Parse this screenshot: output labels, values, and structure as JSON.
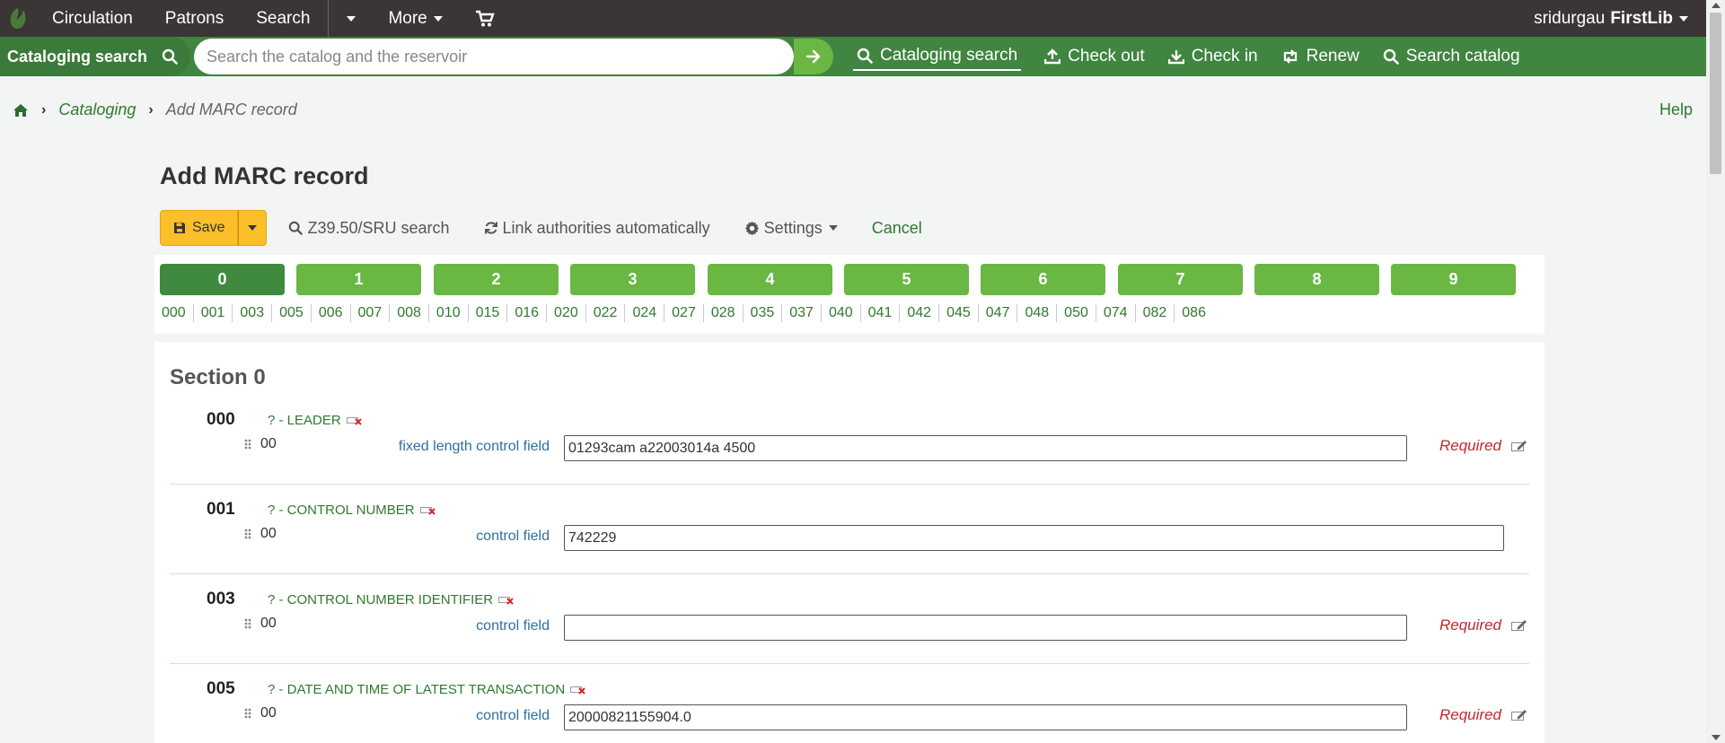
{
  "topnav": {
    "items": [
      "Circulation",
      "Patrons",
      "Search"
    ],
    "more_label": "More",
    "user_name": "sridurgau",
    "library": "FirstLib"
  },
  "searchbar": {
    "label": "Cataloging search",
    "placeholder": "Search the catalog and the reservoir",
    "quick_links": [
      "Cataloging search",
      "Check out",
      "Check in",
      "Renew",
      "Search catalog"
    ]
  },
  "breadcrumb": {
    "link": "Cataloging",
    "current": "Add MARC record"
  },
  "help_label": "Help",
  "page_title": "Add MARC record",
  "toolbar": {
    "save_label": "Save",
    "z3950_label": "Z39.50/SRU search",
    "link_auth_label": "Link authorities automatically",
    "settings_label": "Settings",
    "cancel_label": "Cancel"
  },
  "tabs": [
    "0",
    "1",
    "2",
    "3",
    "4",
    "5",
    "6",
    "7",
    "8",
    "9"
  ],
  "field_links": [
    "000",
    "001",
    "003",
    "005",
    "006",
    "007",
    "008",
    "010",
    "015",
    "016",
    "020",
    "022",
    "024",
    "027",
    "028",
    "035",
    "037",
    "040",
    "041",
    "042",
    "045",
    "047",
    "048",
    "050",
    "074",
    "082",
    "086"
  ],
  "section": {
    "title": "Section 0",
    "tags": [
      {
        "num": "000",
        "title": "? - LEADER",
        "code": "00",
        "label": "fixed length control field",
        "value": "01293cam a22003014a 4500",
        "required": "Required"
      },
      {
        "num": "001",
        "title": "? - CONTROL NUMBER",
        "code": "00",
        "label": "control field",
        "value": "742229",
        "required": ""
      },
      {
        "num": "003",
        "title": "? - CONTROL NUMBER IDENTIFIER",
        "code": "00",
        "label": "control field",
        "value": "",
        "required": "Required"
      },
      {
        "num": "005",
        "title": "? - DATE AND TIME OF LATEST TRANSACTION",
        "code": "00",
        "label": "control field",
        "value": "20000821155904.0",
        "required": "Required"
      }
    ]
  },
  "colors": {
    "nav_bg": "#3b3536",
    "search_bg": "#408540",
    "tab_green": "#6ab744",
    "tab_active": "#3f8a3f",
    "save_yellow": "#fbbf2a",
    "required_red": "#c1272d",
    "link_green": "#2f7a2f"
  }
}
